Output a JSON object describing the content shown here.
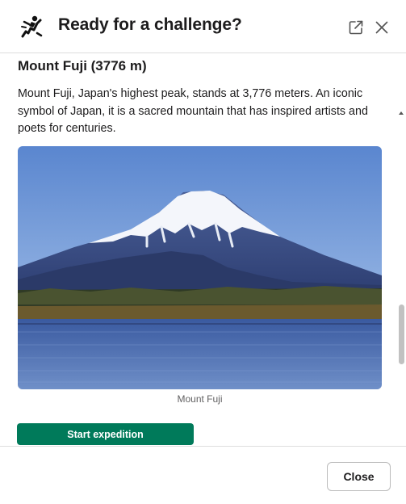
{
  "header": {
    "title": "Ready for a challenge?",
    "app_icon": "climber-logo-icon",
    "open_external_icon": "external-link-icon",
    "close_icon": "close-icon"
  },
  "content": {
    "section_title": "Mount Fuji (3776 m)",
    "description": "Mount Fuji, Japan's highest peak, stands at 3,776 meters. An iconic symbol of Japan, it is a sacred mountain that has inspired artists and poets for centuries.",
    "image_caption": "Mount Fuji",
    "start_button_label": "Start expedition"
  },
  "footer": {
    "close_button_label": "Close"
  },
  "colors": {
    "primary_button": "#007a5a",
    "text": "#1d1c1d",
    "caption": "#616061",
    "divider": "#dddddd"
  }
}
